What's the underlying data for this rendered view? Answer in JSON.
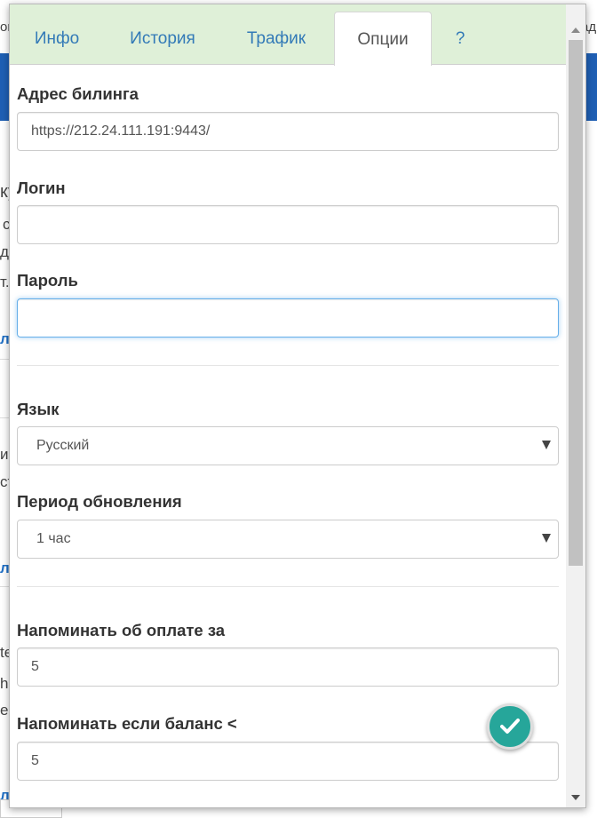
{
  "tabs": [
    {
      "label": "Инфо",
      "active": false
    },
    {
      "label": "История",
      "active": false
    },
    {
      "label": "Трафик",
      "active": false
    },
    {
      "label": "Опции",
      "active": true
    },
    {
      "label": "?",
      "active": false
    }
  ],
  "form": {
    "billing_address": {
      "label": "Адрес билинга",
      "value": "https://212.24.111.191:9443/"
    },
    "login": {
      "label": "Логин",
      "value": ""
    },
    "password": {
      "label": "Пароль",
      "value": ""
    },
    "language": {
      "label": "Язык",
      "selected": "Русский"
    },
    "update_period": {
      "label": "Период обновления",
      "selected": "1 час"
    },
    "remind_payment": {
      "label": "Напоминать об оплате за",
      "value": "5"
    },
    "remind_balance": {
      "label": "Напоминать если баланс <",
      "value": "5"
    }
  },
  "background_fragments": [
    "or",
    "ад",
    "ку",
    "с",
    "ди",
    "т.",
    "л",
    "ис",
    "ст",
    "л",
    "te",
    "h",
    "er",
    "л"
  ],
  "icons": {
    "save": "check-icon",
    "scroll_up": "arrow-up-icon",
    "scroll_down": "arrow-down-icon",
    "select": "chevron-down-icon"
  },
  "colors": {
    "tab_bar": "#dff0d8",
    "tab_link": "#337ab7",
    "fab": "#26a69a",
    "focus": "#66afe9"
  }
}
